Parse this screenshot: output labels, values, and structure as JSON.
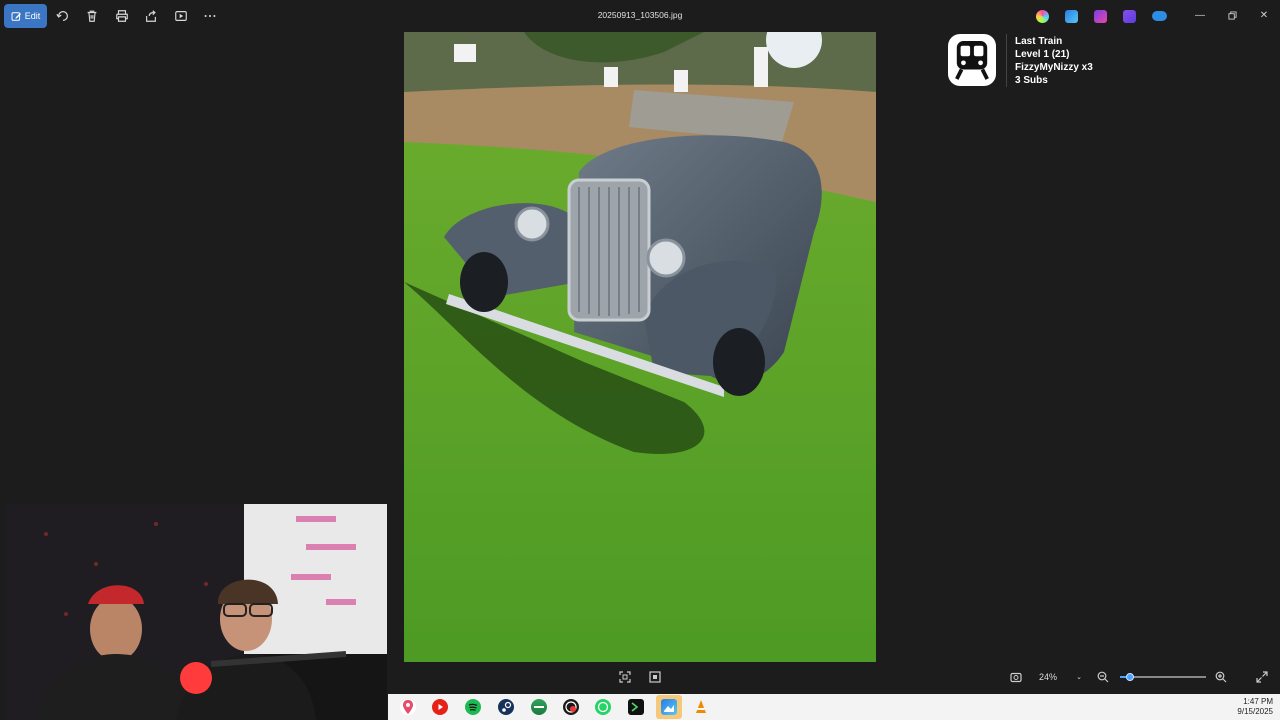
{
  "toolbar": {
    "edit_label": "Edit",
    "icons": [
      "edit-icon",
      "rotate-icon",
      "delete-icon",
      "print-icon",
      "share-icon",
      "slideshow-icon",
      "more-icon"
    ]
  },
  "file": {
    "name": "20250913_103506.jpg"
  },
  "title_apps": [
    "copilot-icon",
    "photos-icon",
    "clipchamp-icon",
    "designer-icon",
    "onedrive-icon"
  ],
  "window_controls": [
    "minimize-icon",
    "restore-icon",
    "close-icon"
  ],
  "overlay": {
    "icon": "train-icon",
    "line1": "Last Train",
    "line2": "Level 1  (21)",
    "line3": "FizzyMyNizzy x3",
    "line4": "3 Subs"
  },
  "viewbar": {
    "zoom_value": "24%",
    "zoom_level": 0.08
  },
  "taskbar": {
    "apps": [
      "maps-icon",
      "youtube-icon",
      "spotify-icon",
      "steam-icon",
      "app-icon",
      "obs-icon",
      "whatsapp-icon",
      "terminal-icon",
      "photos-icon",
      "vlc-icon"
    ],
    "time": "1:47 PM",
    "date": "9/15/2025"
  },
  "colors": {
    "accent": "#3a76c4",
    "background": "#1c1c1c",
    "slider": "#4ea1ff"
  }
}
